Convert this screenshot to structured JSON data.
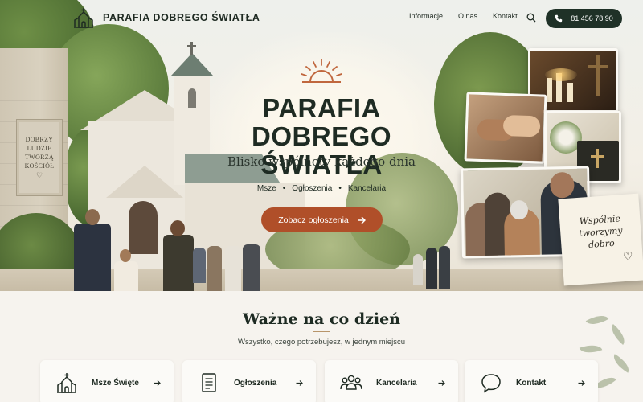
{
  "header": {
    "brand_name": "PARAFIA DOBREGO ŚWIATŁA",
    "nav": [
      "Informacje",
      "O nas",
      "Kontakt"
    ],
    "phone": "81 456 78 90"
  },
  "hero": {
    "title_line1": "PARAFIA",
    "title_line2": "DOBREGO ŚWIATŁA",
    "subtitle": "Blisko wspólnoty każdego dnia",
    "links": [
      "Msze",
      "Ogłoszenia",
      "Kancelaria"
    ],
    "cta_label": "Zobacz ogłoszenia",
    "plaque_lines": [
      "DOBRZY",
      "LUDZIE",
      "TWORZĄ",
      "KOŚCIÓŁ"
    ],
    "note_text": "Wspólnie tworzymy dobro"
  },
  "section": {
    "title": "Ważne na co dzień",
    "subtitle": "Wszystko, czego potrzebujesz, w jednym miejscu",
    "cards": [
      {
        "label": "Msze Święte",
        "icon": "church-icon"
      },
      {
        "label": "Ogłoszenia",
        "icon": "document-icon"
      },
      {
        "label": "Kancelaria",
        "icon": "people-icon"
      },
      {
        "label": "Kontakt",
        "icon": "chat-bubble-icon"
      }
    ]
  },
  "colors": {
    "accent": "#b04f29",
    "dark_green": "#1f3127",
    "background": "#f6f3ee"
  }
}
